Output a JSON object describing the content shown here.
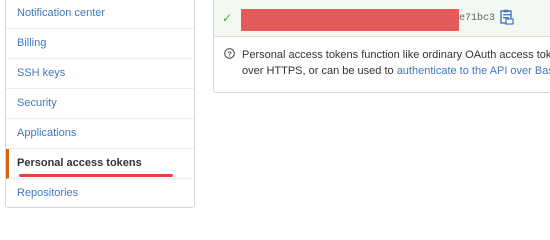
{
  "sidebar": {
    "items": [
      {
        "label": "Notification center"
      },
      {
        "label": "Billing"
      },
      {
        "label": "SSH keys"
      },
      {
        "label": "Security"
      },
      {
        "label": "Applications"
      },
      {
        "label": "Personal access tokens",
        "selected": true
      },
      {
        "label": "Repositories"
      }
    ]
  },
  "token": {
    "masked_prefix": "✓",
    "suffix": "e71bc3",
    "status_color": "#55a532"
  },
  "info": {
    "line1": "Personal access tokens function like ordinary OAuth access tok",
    "line2_prefix": "over HTTPS, or can be used to ",
    "link_text": "authenticate to the API over Bas"
  },
  "colors": {
    "accent": "#4078c0",
    "selected_border": "#d26911",
    "annotation_red": "#e8413f"
  }
}
